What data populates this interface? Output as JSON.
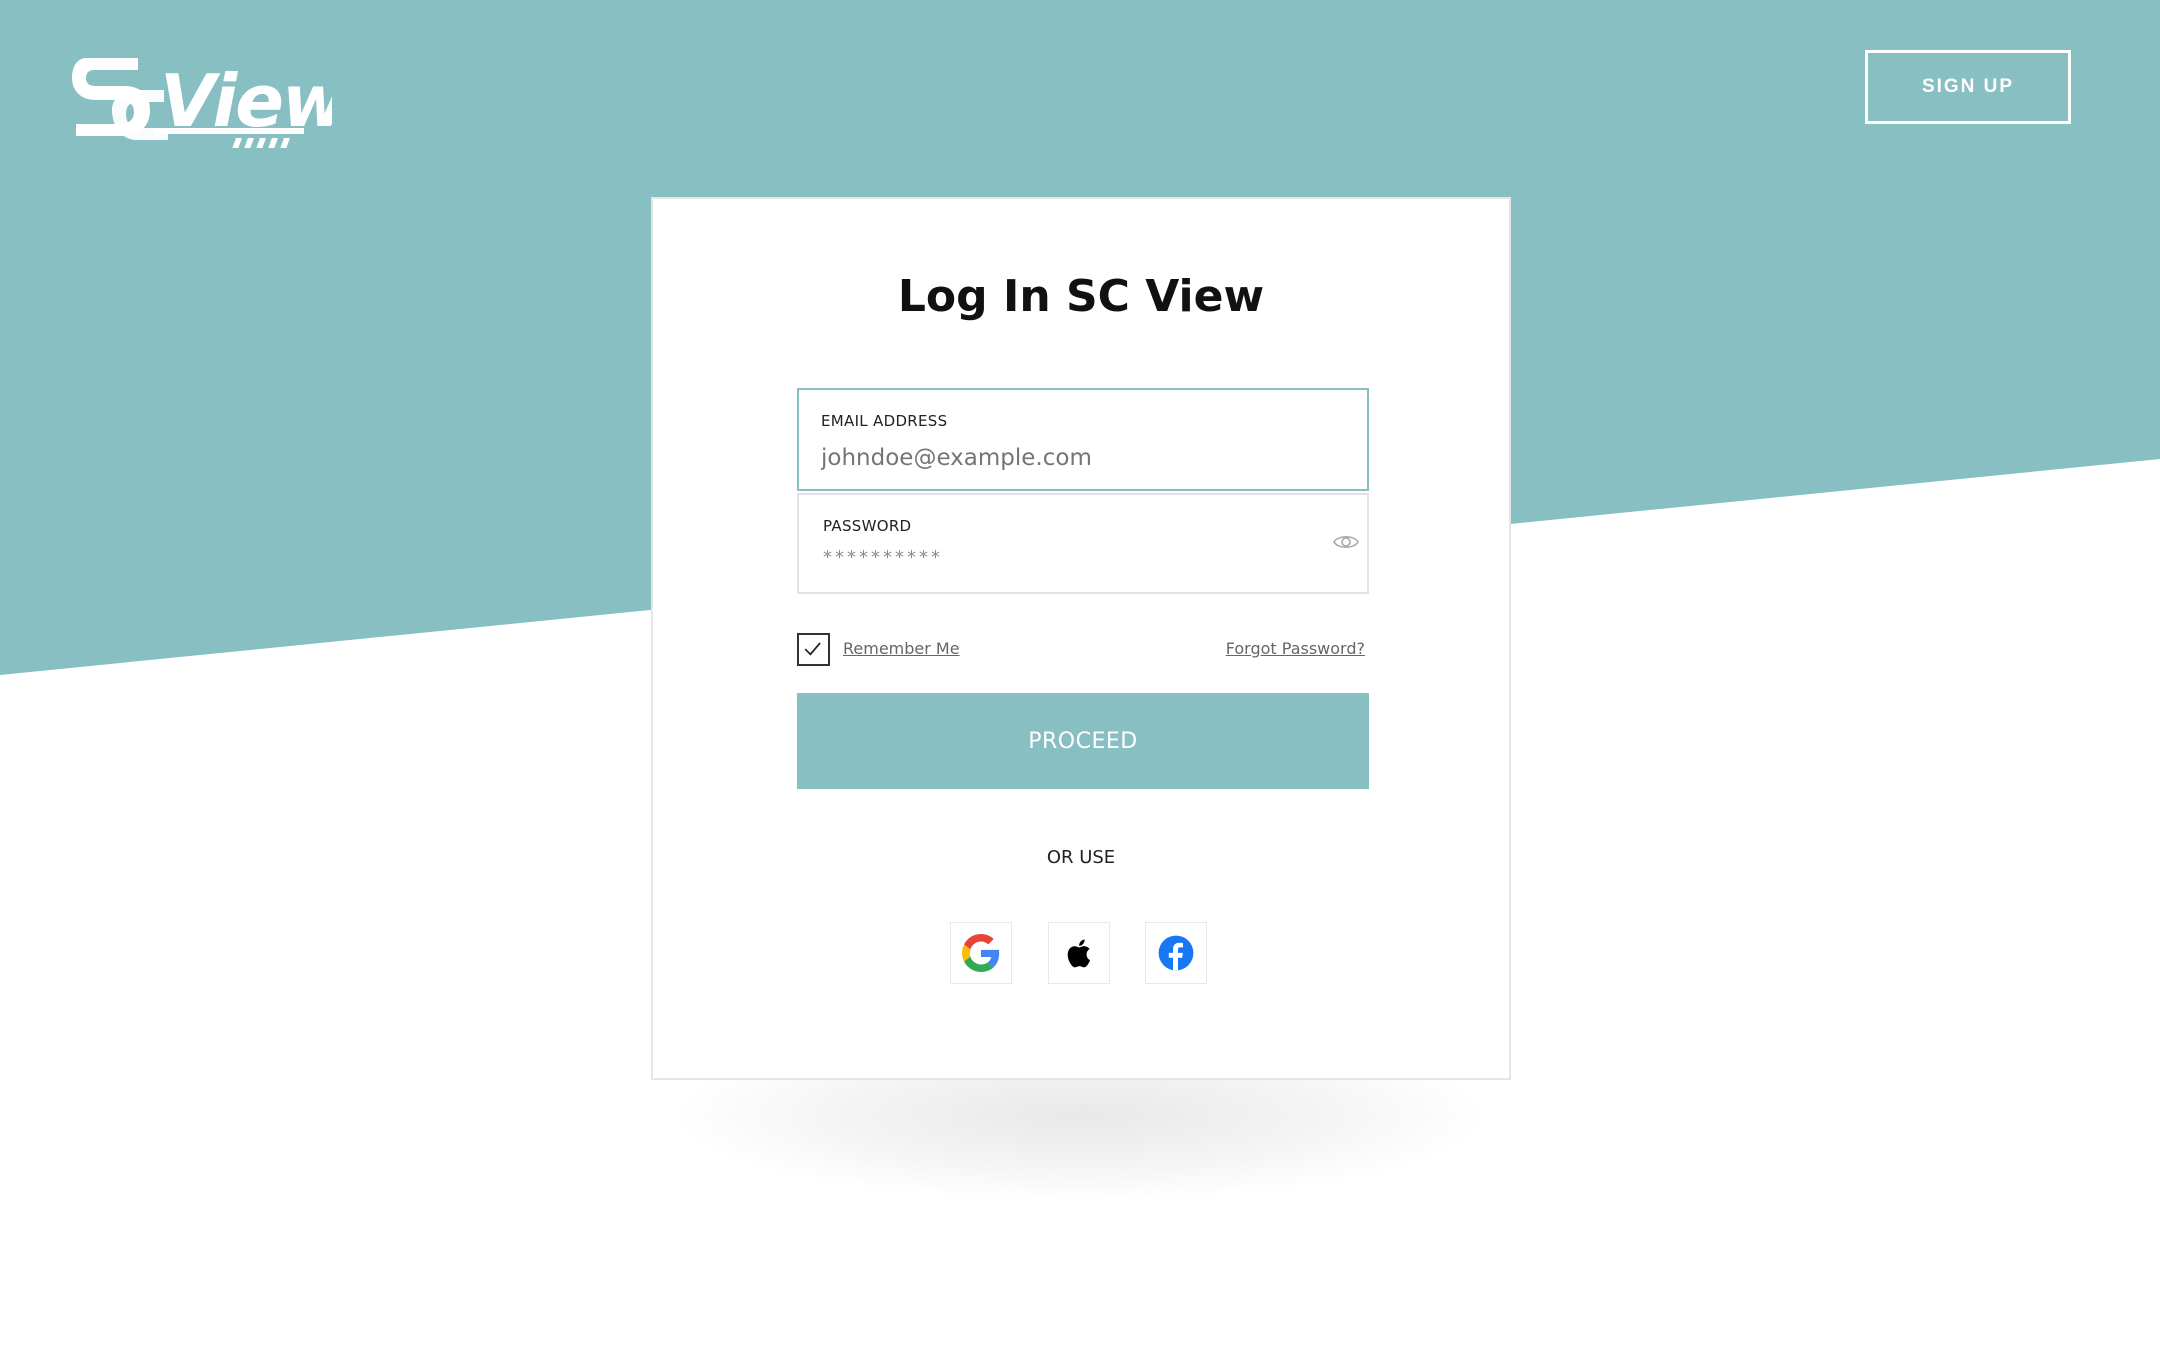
{
  "header": {
    "signup_label": "SIGN UP"
  },
  "login": {
    "title": "Log In SC View",
    "email": {
      "label": "EMAIL ADDRESS",
      "placeholder": "johndoe@example.com"
    },
    "password": {
      "label": "PASSWORD",
      "value": "**********"
    },
    "remember_label": "Remember Me",
    "remember_checked": true,
    "forgot_label": "Forgot Password?",
    "proceed_label": "PROCEED",
    "or_use_label": "OR USE"
  },
  "social": [
    {
      "icon": "google-icon"
    },
    {
      "icon": "apple-icon"
    },
    {
      "icon": "facebook-icon"
    }
  ],
  "colors": {
    "accent": "#88bfc2",
    "text": "#111111",
    "muted": "#666666",
    "facebook": "#1877f2"
  }
}
